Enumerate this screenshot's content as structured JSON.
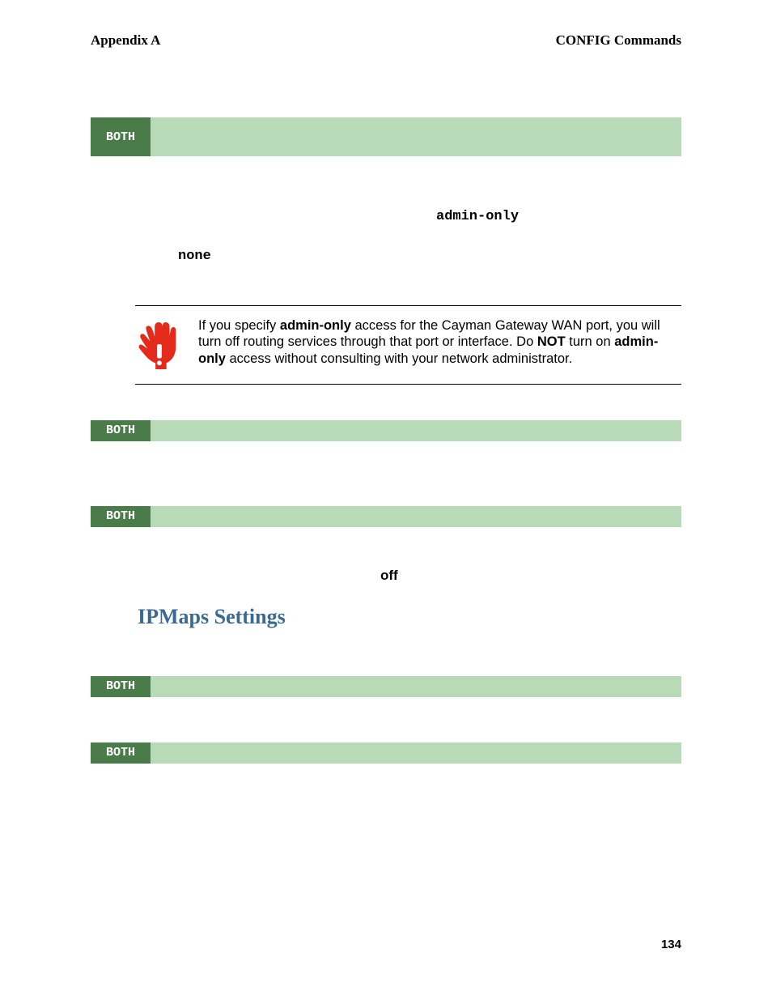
{
  "header": {
    "left": "Appendix A",
    "right": "CONFIG Commands"
  },
  "badges": {
    "b1": "BOTH",
    "b2": "BOTH",
    "b3": "BOTH",
    "b4": "BOTH",
    "b5": "BOTH"
  },
  "block1": {
    "admin_only": "admin-only",
    "none": "none"
  },
  "warning": {
    "p1a": "If you specify ",
    "p1b": "admin-only",
    "p1c": " access for the Cayman Gateway WAN port, you will turn off routing services through that port or interface. Do ",
    "p1d": "NOT",
    "p1e": " turn on ",
    "p1f": "admin-only",
    "p1g": " access without consulting with your network administrator."
  },
  "off_label": "off",
  "section_title": "IPMaps Settings",
  "page_number": "134"
}
